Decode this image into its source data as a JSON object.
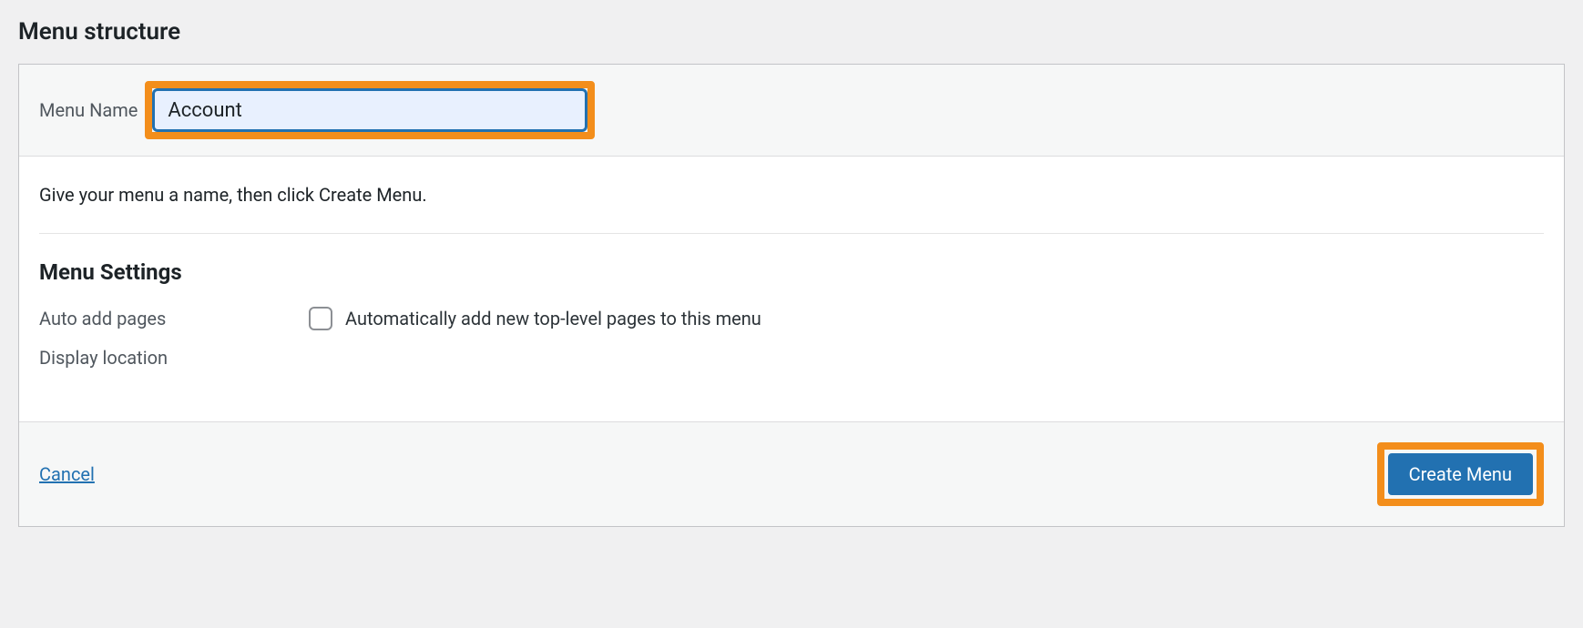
{
  "section_title": "Menu structure",
  "header": {
    "menu_name_label": "Menu Name",
    "menu_name_value": "Account"
  },
  "body": {
    "helper_text": "Give your menu a name, then click Create Menu.",
    "settings_heading": "Menu Settings",
    "auto_add_label": "Auto add pages",
    "auto_add_checkbox_label": "Automatically add new top-level pages to this menu",
    "display_location_label": "Display location"
  },
  "footer": {
    "cancel_label": "Cancel",
    "create_label": "Create Menu"
  }
}
